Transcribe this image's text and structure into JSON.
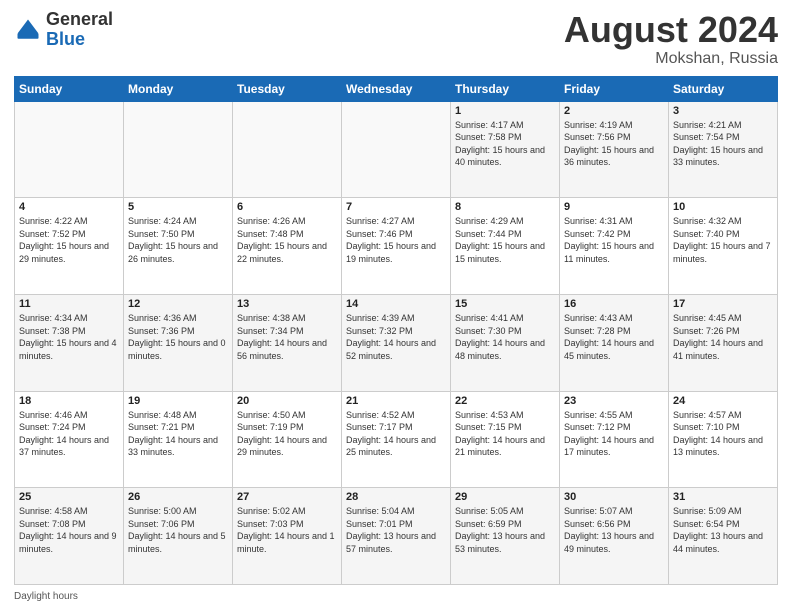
{
  "header": {
    "logo_general": "General",
    "logo_blue": "Blue",
    "title": "August 2024",
    "location": "Mokshan, Russia"
  },
  "footer": {
    "daylight_label": "Daylight hours"
  },
  "weekdays": [
    "Sunday",
    "Monday",
    "Tuesday",
    "Wednesday",
    "Thursday",
    "Friday",
    "Saturday"
  ],
  "weeks": [
    [
      {
        "day": "",
        "sunrise": "",
        "sunset": "",
        "daylight": ""
      },
      {
        "day": "",
        "sunrise": "",
        "sunset": "",
        "daylight": ""
      },
      {
        "day": "",
        "sunrise": "",
        "sunset": "",
        "daylight": ""
      },
      {
        "day": "",
        "sunrise": "",
        "sunset": "",
        "daylight": ""
      },
      {
        "day": "1",
        "sunrise": "Sunrise: 4:17 AM",
        "sunset": "Sunset: 7:58 PM",
        "daylight": "Daylight: 15 hours and 40 minutes."
      },
      {
        "day": "2",
        "sunrise": "Sunrise: 4:19 AM",
        "sunset": "Sunset: 7:56 PM",
        "daylight": "Daylight: 15 hours and 36 minutes."
      },
      {
        "day": "3",
        "sunrise": "Sunrise: 4:21 AM",
        "sunset": "Sunset: 7:54 PM",
        "daylight": "Daylight: 15 hours and 33 minutes."
      }
    ],
    [
      {
        "day": "4",
        "sunrise": "Sunrise: 4:22 AM",
        "sunset": "Sunset: 7:52 PM",
        "daylight": "Daylight: 15 hours and 29 minutes."
      },
      {
        "day": "5",
        "sunrise": "Sunrise: 4:24 AM",
        "sunset": "Sunset: 7:50 PM",
        "daylight": "Daylight: 15 hours and 26 minutes."
      },
      {
        "day": "6",
        "sunrise": "Sunrise: 4:26 AM",
        "sunset": "Sunset: 7:48 PM",
        "daylight": "Daylight: 15 hours and 22 minutes."
      },
      {
        "day": "7",
        "sunrise": "Sunrise: 4:27 AM",
        "sunset": "Sunset: 7:46 PM",
        "daylight": "Daylight: 15 hours and 19 minutes."
      },
      {
        "day": "8",
        "sunrise": "Sunrise: 4:29 AM",
        "sunset": "Sunset: 7:44 PM",
        "daylight": "Daylight: 15 hours and 15 minutes."
      },
      {
        "day": "9",
        "sunrise": "Sunrise: 4:31 AM",
        "sunset": "Sunset: 7:42 PM",
        "daylight": "Daylight: 15 hours and 11 minutes."
      },
      {
        "day": "10",
        "sunrise": "Sunrise: 4:32 AM",
        "sunset": "Sunset: 7:40 PM",
        "daylight": "Daylight: 15 hours and 7 minutes."
      }
    ],
    [
      {
        "day": "11",
        "sunrise": "Sunrise: 4:34 AM",
        "sunset": "Sunset: 7:38 PM",
        "daylight": "Daylight: 15 hours and 4 minutes."
      },
      {
        "day": "12",
        "sunrise": "Sunrise: 4:36 AM",
        "sunset": "Sunset: 7:36 PM",
        "daylight": "Daylight: 15 hours and 0 minutes."
      },
      {
        "day": "13",
        "sunrise": "Sunrise: 4:38 AM",
        "sunset": "Sunset: 7:34 PM",
        "daylight": "Daylight: 14 hours and 56 minutes."
      },
      {
        "day": "14",
        "sunrise": "Sunrise: 4:39 AM",
        "sunset": "Sunset: 7:32 PM",
        "daylight": "Daylight: 14 hours and 52 minutes."
      },
      {
        "day": "15",
        "sunrise": "Sunrise: 4:41 AM",
        "sunset": "Sunset: 7:30 PM",
        "daylight": "Daylight: 14 hours and 48 minutes."
      },
      {
        "day": "16",
        "sunrise": "Sunrise: 4:43 AM",
        "sunset": "Sunset: 7:28 PM",
        "daylight": "Daylight: 14 hours and 45 minutes."
      },
      {
        "day": "17",
        "sunrise": "Sunrise: 4:45 AM",
        "sunset": "Sunset: 7:26 PM",
        "daylight": "Daylight: 14 hours and 41 minutes."
      }
    ],
    [
      {
        "day": "18",
        "sunrise": "Sunrise: 4:46 AM",
        "sunset": "Sunset: 7:24 PM",
        "daylight": "Daylight: 14 hours and 37 minutes."
      },
      {
        "day": "19",
        "sunrise": "Sunrise: 4:48 AM",
        "sunset": "Sunset: 7:21 PM",
        "daylight": "Daylight: 14 hours and 33 minutes."
      },
      {
        "day": "20",
        "sunrise": "Sunrise: 4:50 AM",
        "sunset": "Sunset: 7:19 PM",
        "daylight": "Daylight: 14 hours and 29 minutes."
      },
      {
        "day": "21",
        "sunrise": "Sunrise: 4:52 AM",
        "sunset": "Sunset: 7:17 PM",
        "daylight": "Daylight: 14 hours and 25 minutes."
      },
      {
        "day": "22",
        "sunrise": "Sunrise: 4:53 AM",
        "sunset": "Sunset: 7:15 PM",
        "daylight": "Daylight: 14 hours and 21 minutes."
      },
      {
        "day": "23",
        "sunrise": "Sunrise: 4:55 AM",
        "sunset": "Sunset: 7:12 PM",
        "daylight": "Daylight: 14 hours and 17 minutes."
      },
      {
        "day": "24",
        "sunrise": "Sunrise: 4:57 AM",
        "sunset": "Sunset: 7:10 PM",
        "daylight": "Daylight: 14 hours and 13 minutes."
      }
    ],
    [
      {
        "day": "25",
        "sunrise": "Sunrise: 4:58 AM",
        "sunset": "Sunset: 7:08 PM",
        "daylight": "Daylight: 14 hours and 9 minutes."
      },
      {
        "day": "26",
        "sunrise": "Sunrise: 5:00 AM",
        "sunset": "Sunset: 7:06 PM",
        "daylight": "Daylight: 14 hours and 5 minutes."
      },
      {
        "day": "27",
        "sunrise": "Sunrise: 5:02 AM",
        "sunset": "Sunset: 7:03 PM",
        "daylight": "Daylight: 14 hours and 1 minute."
      },
      {
        "day": "28",
        "sunrise": "Sunrise: 5:04 AM",
        "sunset": "Sunset: 7:01 PM",
        "daylight": "Daylight: 13 hours and 57 minutes."
      },
      {
        "day": "29",
        "sunrise": "Sunrise: 5:05 AM",
        "sunset": "Sunset: 6:59 PM",
        "daylight": "Daylight: 13 hours and 53 minutes."
      },
      {
        "day": "30",
        "sunrise": "Sunrise: 5:07 AM",
        "sunset": "Sunset: 6:56 PM",
        "daylight": "Daylight: 13 hours and 49 minutes."
      },
      {
        "day": "31",
        "sunrise": "Sunrise: 5:09 AM",
        "sunset": "Sunset: 6:54 PM",
        "daylight": "Daylight: 13 hours and 44 minutes."
      }
    ]
  ]
}
